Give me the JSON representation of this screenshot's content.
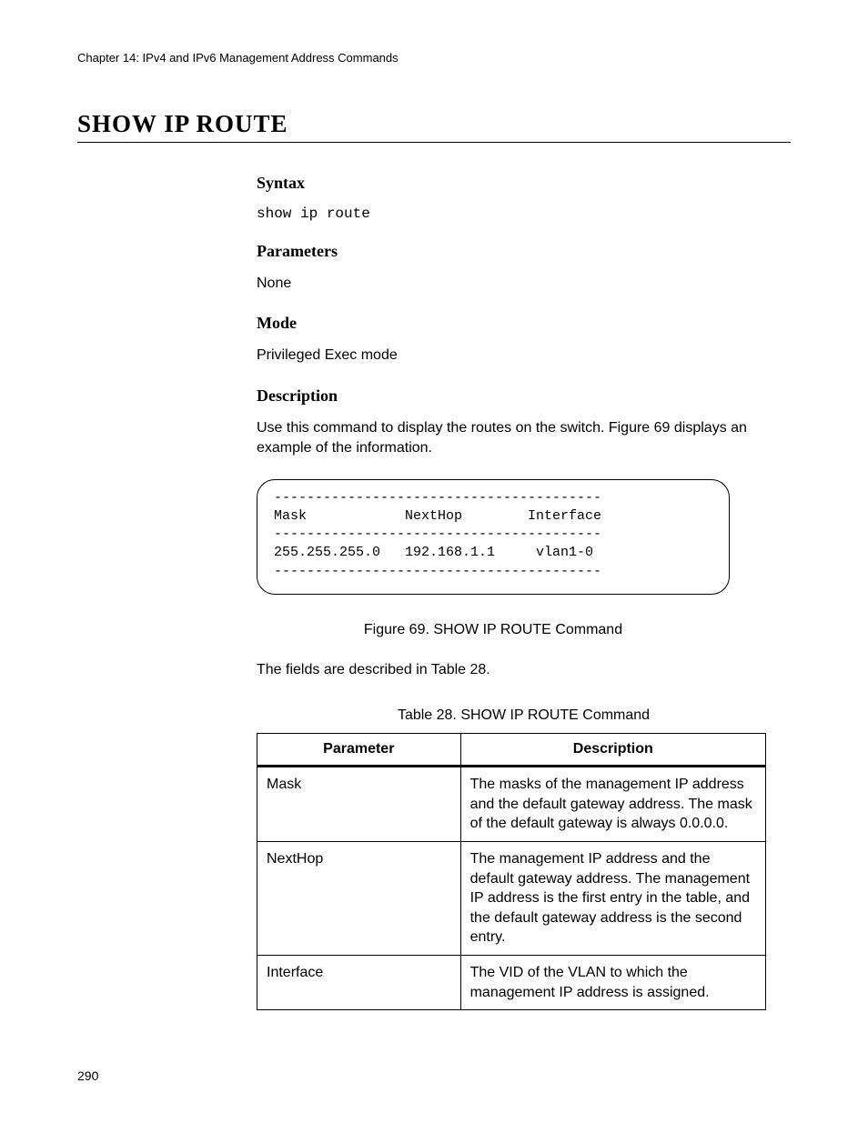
{
  "chapter": "Chapter 14: IPv4 and IPv6 Management Address Commands",
  "title": "SHOW IP ROUTE",
  "sections": {
    "syntax": {
      "heading": "Syntax",
      "code": "show ip route"
    },
    "parameters": {
      "heading": "Parameters",
      "text": "None"
    },
    "mode": {
      "heading": "Mode",
      "text": "Privileged Exec mode"
    },
    "description": {
      "heading": "Description",
      "text": "Use this command to display the routes on the switch. Figure 69 displays an example of the information."
    }
  },
  "terminal": "----------------------------------------\nMask            NextHop        Interface\n----------------------------------------\n255.255.255.0   192.168.1.1     vlan1-0\n----------------------------------------",
  "figure_caption": "Figure 69. SHOW IP ROUTE Command",
  "fields_intro": "The fields are described in Table 28.",
  "table_caption": "Table 28. SHOW IP ROUTE Command",
  "table": {
    "headers": {
      "param": "Parameter",
      "desc": "Description"
    },
    "rows": [
      {
        "param": "Mask",
        "desc": "The masks of the management IP address and the default gateway address. The mask of the default gateway is always 0.0.0.0."
      },
      {
        "param": "NextHop",
        "desc": "The management IP address and the default gateway address. The management IP address is the first entry in the table, and the default gateway address is the second entry."
      },
      {
        "param": "Interface",
        "desc": "The VID of the VLAN to which the management IP address is assigned."
      }
    ]
  },
  "page_number": "290"
}
